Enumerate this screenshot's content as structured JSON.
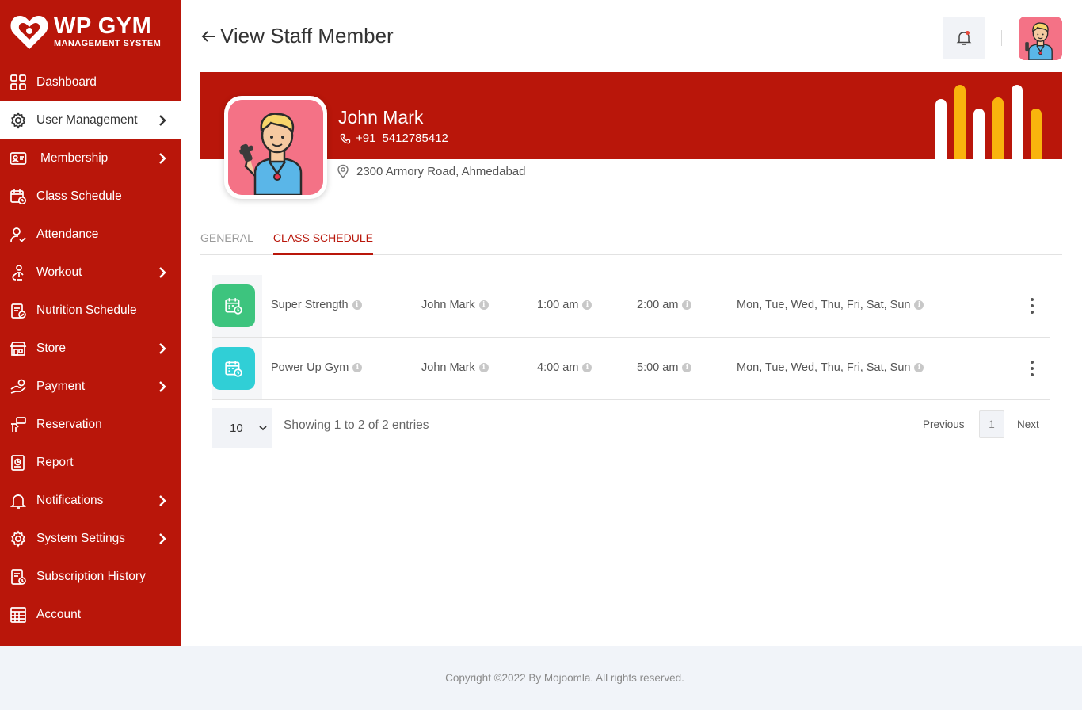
{
  "brand": {
    "title": "WP GYM",
    "subtitle": "MANAGEMENT SYSTEM"
  },
  "sidebar": {
    "items": [
      {
        "label": "Dashboard",
        "icon": "dashboard-icon",
        "has_submenu": false,
        "active": false
      },
      {
        "label": "User Management",
        "icon": "users-gear-icon",
        "has_submenu": true,
        "active": true
      },
      {
        "label": "Membership",
        "icon": "membership-card-icon",
        "has_submenu": true,
        "active": false
      },
      {
        "label": "Class Schedule",
        "icon": "calendar-icon",
        "has_submenu": false,
        "active": false
      },
      {
        "label": "Attendance",
        "icon": "attendance-icon",
        "has_submenu": false,
        "active": false
      },
      {
        "label": "Workout",
        "icon": "workout-icon",
        "has_submenu": true,
        "active": false
      },
      {
        "label": "Nutrition Schedule",
        "icon": "nutrition-icon",
        "has_submenu": false,
        "active": false
      },
      {
        "label": "Store",
        "icon": "store-icon",
        "has_submenu": true,
        "active": false
      },
      {
        "label": "Payment",
        "icon": "payment-icon",
        "has_submenu": true,
        "active": false
      },
      {
        "label": "Reservation",
        "icon": "reservation-icon",
        "has_submenu": false,
        "active": false
      },
      {
        "label": "Report",
        "icon": "report-icon",
        "has_submenu": false,
        "active": false
      },
      {
        "label": "Notifications",
        "icon": "bell-icon",
        "has_submenu": true,
        "active": false
      },
      {
        "label": "System Settings",
        "icon": "gear-icon",
        "has_submenu": true,
        "active": false
      },
      {
        "label": "Subscription History",
        "icon": "subscription-history-icon",
        "has_submenu": false,
        "active": false
      },
      {
        "label": "Account",
        "icon": "account-icon",
        "has_submenu": false,
        "active": false
      }
    ]
  },
  "header": {
    "title": "View Staff Member"
  },
  "profile": {
    "name": "John Mark",
    "phone_code": "+91",
    "phone": "5412785412",
    "address": "2300 Armory Road, Ahmedabad"
  },
  "tabs": [
    {
      "label": "GENERAL",
      "active": false
    },
    {
      "label": "CLASS SCHEDULE",
      "active": true
    }
  ],
  "schedule": [
    {
      "class_name": "Super Strength",
      "staff": "John Mark",
      "start": "1:00 am",
      "end": "2:00 am",
      "days": "Mon, Tue, Wed, Thu, Fri, Sat, Sun",
      "icon_color": "#3dc47e"
    },
    {
      "class_name": "Power Up Gym",
      "staff": "John Mark",
      "start": "4:00 am",
      "end": "5:00 am",
      "days": "Mon, Tue, Wed, Thu, Fri, Sat, Sun",
      "icon_color": "#30cfd6"
    }
  ],
  "table_footer": {
    "page_size": "10",
    "showing": "Showing 1 to 2 of 2 entries",
    "previous": "Previous",
    "current_page": "1",
    "next": "Next"
  },
  "footer": {
    "copyright": "Copyright ©2022 By Mojoomla. All rights reserved."
  },
  "colors": {
    "brand_red": "#b9160a",
    "bar_white": "#ffffff",
    "bar_yellow": "#f9b40d",
    "avatar_bg": "#f47286"
  }
}
